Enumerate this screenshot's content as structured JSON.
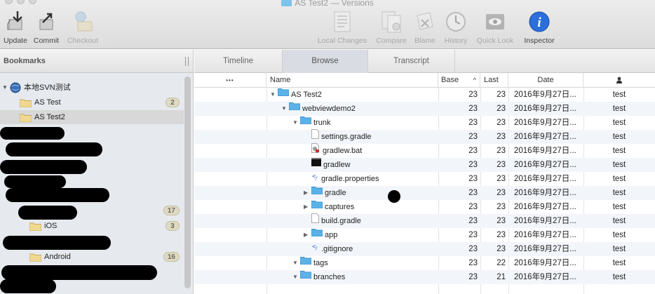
{
  "window": {
    "title": "AS Test2 — Versions"
  },
  "toolbar": {
    "left": [
      {
        "id": "update",
        "label": "Update",
        "icon": "update-icon",
        "enabled": true
      },
      {
        "id": "commit",
        "label": "Commit",
        "icon": "commit-icon",
        "enabled": true
      },
      {
        "id": "checkout",
        "label": "Checkout",
        "icon": "checkout-icon",
        "enabled": false
      }
    ],
    "right": [
      {
        "id": "local-changes",
        "label": "Local Changes",
        "icon": "local-changes-icon",
        "enabled": false
      },
      {
        "id": "compare",
        "label": "Compare",
        "icon": "compare-icon",
        "enabled": false
      },
      {
        "id": "blame",
        "label": "Blame",
        "icon": "blame-icon",
        "enabled": false
      },
      {
        "id": "history",
        "label": "History",
        "icon": "history-icon",
        "enabled": false
      },
      {
        "id": "quick-look",
        "label": "Quick Look",
        "icon": "eye-icon",
        "enabled": false
      },
      {
        "id": "inspector",
        "label": "Inspector",
        "icon": "info-icon",
        "enabled": true
      }
    ]
  },
  "sidebar": {
    "header": "Bookmarks",
    "repo": {
      "label": "本地SVN测试"
    },
    "items": [
      {
        "label": "AS Test",
        "badge": "2"
      },
      {
        "label": "AS Test2",
        "badge": ""
      },
      {
        "label": "",
        "badge": "17"
      },
      {
        "label": "iOS",
        "badge": "3"
      },
      {
        "label": "Android",
        "badge": "16"
      }
    ]
  },
  "tabs": [
    "Timeline",
    "Browse",
    "Transcript"
  ],
  "table": {
    "headers": {
      "more": "•••",
      "name": "Name",
      "base": "Base",
      "last": "Last",
      "date": "Date",
      "author": "👤"
    },
    "rows": [
      {
        "name": "AS Test2",
        "type": "folder",
        "disclosure": "open",
        "base": "23",
        "last": "23",
        "date": "2016年9月27日...",
        "author": "test"
      },
      {
        "name": "webviewdemo2",
        "type": "folder",
        "disclosure": "open",
        "base": "23",
        "last": "23",
        "date": "2016年9月27日...",
        "author": "test"
      },
      {
        "name": "trunk",
        "type": "folder",
        "disclosure": "open",
        "base": "23",
        "last": "23",
        "date": "2016年9月27日...",
        "author": "test"
      },
      {
        "name": "settings.gradle",
        "type": "file",
        "disclosure": "",
        "base": "23",
        "last": "23",
        "date": "2016年9月27日...",
        "author": "test"
      },
      {
        "name": "gradlew.bat",
        "type": "bat",
        "disclosure": "",
        "base": "23",
        "last": "23",
        "date": "2016年9月27日...",
        "author": "test"
      },
      {
        "name": "gradlew",
        "type": "exec",
        "disclosure": "",
        "base": "23",
        "last": "23",
        "date": "2016年9月27日...",
        "author": "test"
      },
      {
        "name": "gradle.properties",
        "type": "code",
        "disclosure": "",
        "base": "23",
        "last": "23",
        "date": "2016年9月27日...",
        "author": "test"
      },
      {
        "name": "gradle",
        "type": "folder",
        "disclosure": "closed",
        "base": "23",
        "last": "23",
        "date": "2016年9月27日...",
        "author": "test"
      },
      {
        "name": "captures",
        "type": "folder",
        "disclosure": "closed",
        "base": "23",
        "last": "23",
        "date": "2016年9月27日...",
        "author": "test"
      },
      {
        "name": "build.gradle",
        "type": "file",
        "disclosure": "",
        "base": "23",
        "last": "23",
        "date": "2016年9月27日...",
        "author": "test"
      },
      {
        "name": "app",
        "type": "folder",
        "disclosure": "closed",
        "base": "23",
        "last": "23",
        "date": "2016年9月27日...",
        "author": "test"
      },
      {
        "name": ".gitignore",
        "type": "code",
        "disclosure": "",
        "base": "23",
        "last": "23",
        "date": "2016年9月27日...",
        "author": "test"
      },
      {
        "name": "tags",
        "type": "folder",
        "disclosure": "open",
        "base": "23",
        "last": "22",
        "date": "2016年9月27日...",
        "author": "test"
      },
      {
        "name": "branches",
        "type": "folder",
        "disclosure": "open",
        "base": "23",
        "last": "21",
        "date": "2016年9月27日...",
        "author": "test"
      }
    ]
  },
  "colors": {
    "folder": "#5bb2e8",
    "info": "#2a6fdb",
    "selection": "#d8d8d8",
    "badge": "#dedac4"
  }
}
